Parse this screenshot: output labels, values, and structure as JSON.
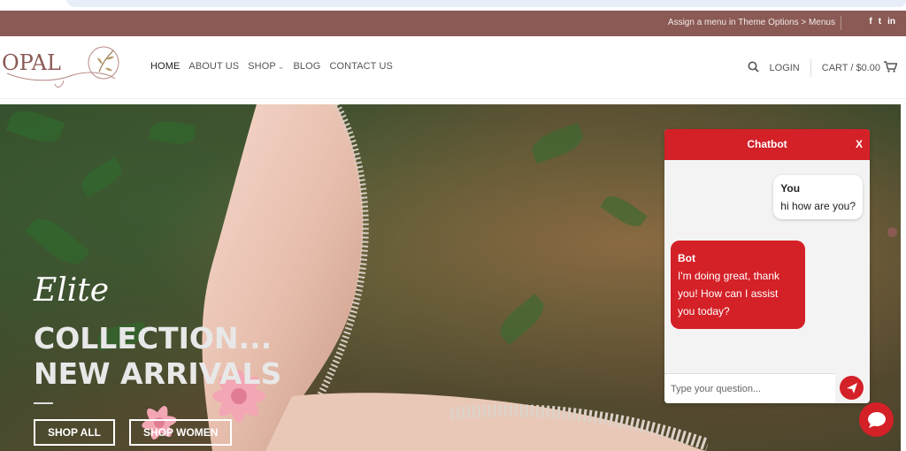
{
  "topbar": {
    "menu_note": "Assign a menu in Theme Options > Menus",
    "socials": [
      {
        "icon": "facebook-icon",
        "glyph": "f"
      },
      {
        "icon": "twitter-icon",
        "glyph": "t"
      },
      {
        "icon": "linkedin-icon",
        "glyph": "in"
      }
    ]
  },
  "header": {
    "logo_text": "OPAL",
    "nav": [
      {
        "label": "HOME",
        "active": true
      },
      {
        "label": "ABOUT US"
      },
      {
        "label": "SHOP",
        "has_dropdown": true
      },
      {
        "label": "BLOG"
      },
      {
        "label": "CONTACT US"
      }
    ],
    "login": "LOGIN",
    "cart": "CART / $0.00"
  },
  "hero": {
    "script_title": "Elite",
    "line1": "COLLECTION...",
    "line2": "NEW ARRIVALS",
    "btn_shop_all": "SHOP ALL",
    "btn_shop_women": "SHOP WOMEN"
  },
  "chatbot": {
    "title": "Chatbot",
    "close": "X",
    "user_label": "You",
    "user_message": "hi how are you?",
    "bot_label": "Bot",
    "bot_message": "I'm doing great, thank you! How can I assist you today?",
    "input_placeholder": "Type your question..."
  },
  "colors": {
    "brand": "#8b5a55",
    "accent": "#d42027"
  }
}
